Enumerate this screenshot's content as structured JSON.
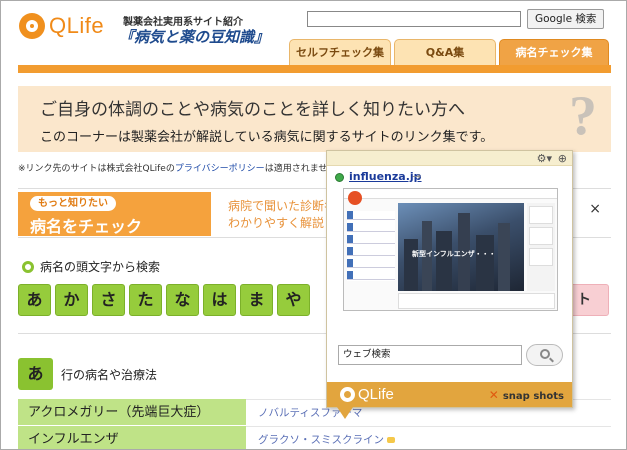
{
  "header": {
    "logo_text": "QLife",
    "tagline_small": "製薬会社実用系サイト紹介",
    "tagline_big": "『病気と薬の豆知識』",
    "search_value": "",
    "google_button": "Google 検索"
  },
  "tabs": [
    {
      "label": "セルフチェック集",
      "active": false
    },
    {
      "label": "Q&A集",
      "active": false
    },
    {
      "label": "病名チェック集",
      "active": true
    }
  ],
  "banner": {
    "line1": "ご自身の体調のことや病気のことを詳しく知りたい方へ",
    "line2": "このコーナーは製薬会社が解説している病気に関するサイトのリンク集です。",
    "question_mark": "?"
  },
  "notice": {
    "prefix": "※リンク先のサイトは株式会社QLifeの",
    "link": "プライバシーポリシー",
    "suffix": "は適用されません"
  },
  "moreinfo": {
    "pill": "もっと知りたい",
    "title": "病名をチェック",
    "text_line1": "病院で聞いた診断名",
    "text_line2": "わかりやすく解説",
    "close": "×"
  },
  "initial_search": {
    "title": "病名の頭文字から検索",
    "kana": [
      "あ",
      "か",
      "さ",
      "た",
      "な",
      "は",
      "ま",
      "や"
    ],
    "end_label": "ト"
  },
  "a_section": {
    "badge": "あ",
    "label": "行の病名や治療法"
  },
  "table": {
    "rows": [
      {
        "name": "アクロメガリー（先端巨大症）",
        "link": "ノバルティスファーマ"
      },
      {
        "name": "インフルエンザ",
        "link": "グラクソ・スミスクライン"
      }
    ]
  },
  "popup": {
    "url": "influenza.jp",
    "arrow": "→",
    "thumb_caption": "新型インフルエンザ・・・",
    "web_search_value": "ウェブ検索",
    "footer_logo": "QLife",
    "footer_snap": "snap shots"
  },
  "icons": {
    "gear": "gear-icon",
    "zoom": "zoom-icon",
    "search": "search-icon"
  },
  "colors": {
    "brand_orange": "#f29c30",
    "kana_green": "#96cc3c",
    "row_green": "#bfe387",
    "link_blue": "#1f4ba8"
  }
}
